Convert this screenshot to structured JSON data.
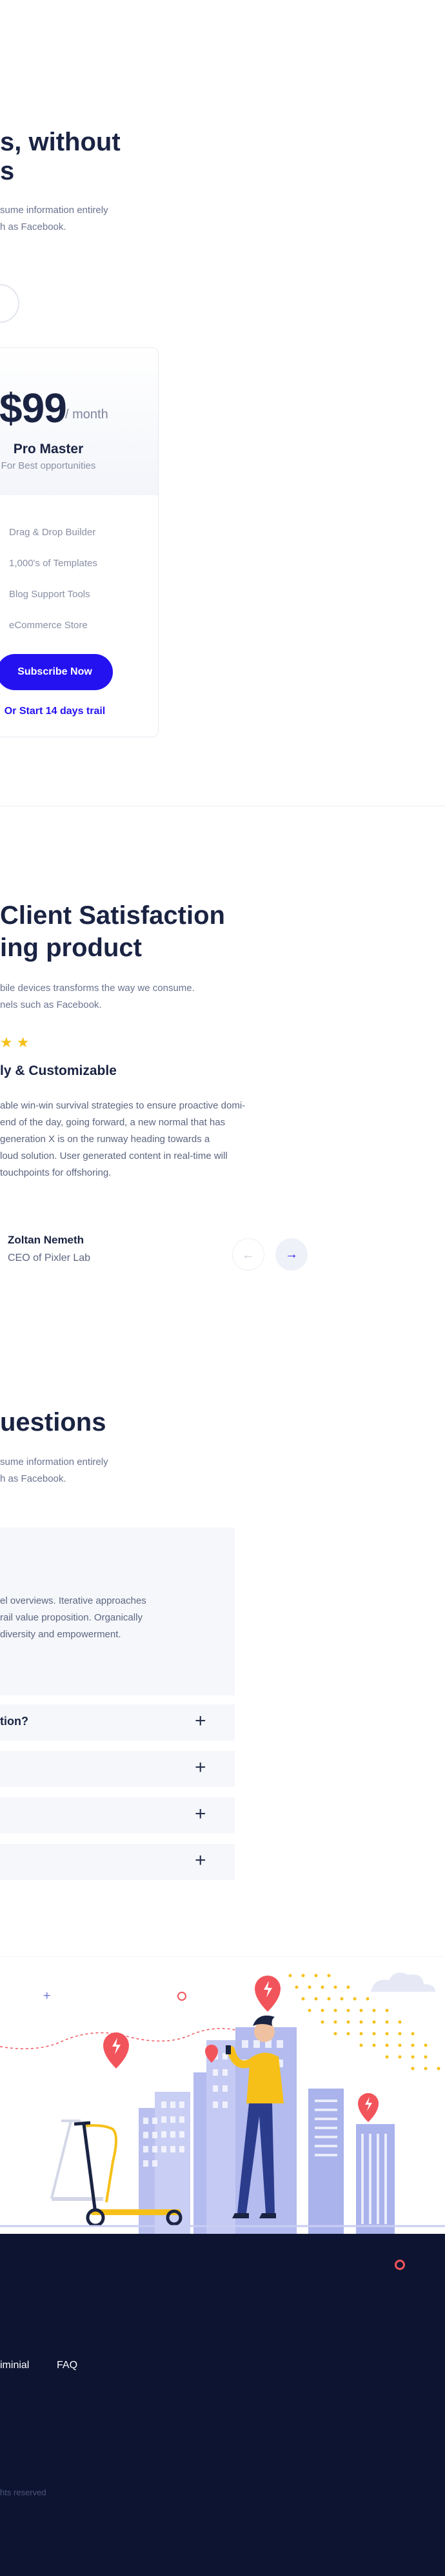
{
  "pricing": {
    "heading_line1": "s, without",
    "heading_line2": "s",
    "subtitle_line1": "sume information entirely",
    "subtitle_line2": "h as Facebook.",
    "card": {
      "price": "$99",
      "period": "/ month",
      "plan_name": "Pro Master",
      "plan_subtitle": "For Best opportunities",
      "features": [
        "Drag & Drop Builder",
        "1,000's of Templates",
        "Blog Support Tools",
        "eCommerce Store"
      ],
      "subscribe_label": "Subscribe Now",
      "trial_label": "Or Start 14 days trail"
    }
  },
  "testimonials": {
    "heading_line1": "Client Satisfaction",
    "heading_line2": "ing product",
    "subtitle_line1": "bile devices transforms the way we consume.",
    "subtitle_line2": "nels such as Facebook.",
    "stars": "★★",
    "rating": 5,
    "title": "ly & Customizable",
    "body_lines": [
      "able win-win survival strategies to ensure proactive domi-",
      "end of the day, going forward, a new normal that has",
      "generation X is on the runway heading towards a",
      "loud solution. User generated content in real-time will",
      "touchpoints for offshoring."
    ],
    "author_name": "Zoltan Nemeth",
    "author_role": "CEO of Pixler Lab",
    "prev_icon": "←",
    "next_icon": "→"
  },
  "faq": {
    "heading": "uestions",
    "subtitle_line1": "sume information entirely",
    "subtitle_line2": "h as Facebook.",
    "open_answer_lines": [
      "el overviews. Iterative approaches",
      "rail value proposition. Organically",
      "diversity and empowerment."
    ],
    "items": [
      {
        "question": "tion?",
        "icon": "+"
      },
      {
        "question": "",
        "icon": "+"
      },
      {
        "question": "",
        "icon": "+"
      },
      {
        "question": "",
        "icon": "+"
      }
    ]
  },
  "footer": {
    "links": [
      "iminial",
      "FAQ"
    ],
    "copyright": "hts reserved"
  },
  "colors": {
    "accent": "#2412f0",
    "navy": "#1a2342",
    "star": "#f6c018",
    "footer_bg": "#0c1431",
    "pin_red": "#f2545b"
  }
}
